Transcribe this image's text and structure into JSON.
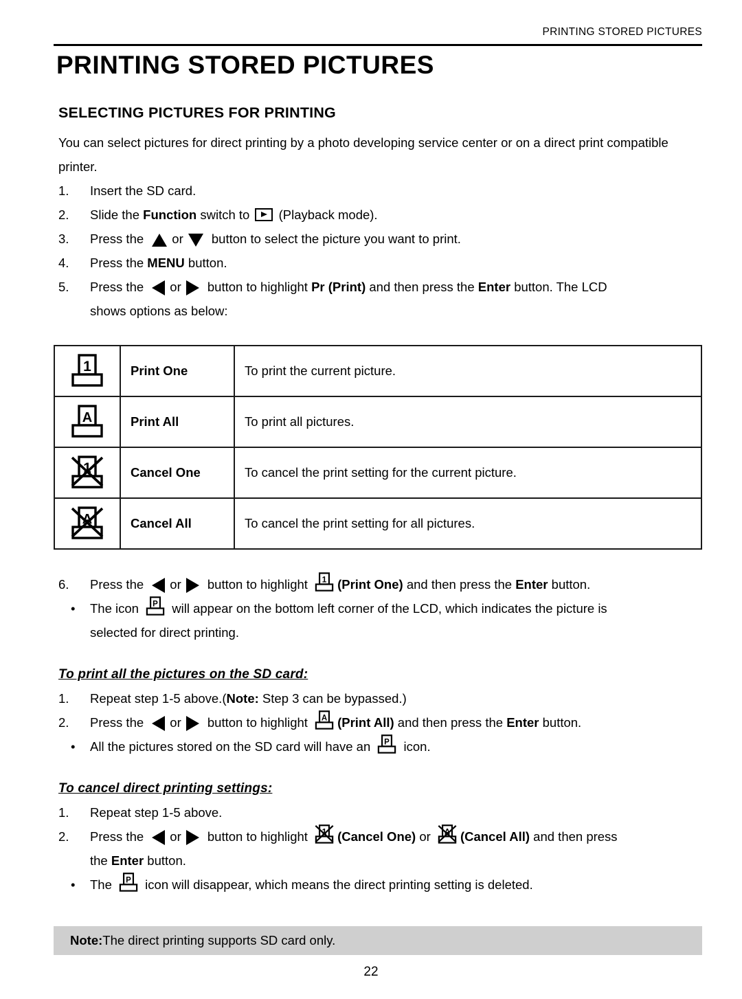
{
  "header": {
    "running_head": "PRINTING STORED PICTURES",
    "chapter_title": "PRINTING STORED PICTURES"
  },
  "section": {
    "heading": "SELECTING PICTURES FOR PRINTING",
    "intro": "You can select pictures for direct printing by a photo developing service center or on a direct print compatible printer."
  },
  "steps": {
    "s1": {
      "num": "1.",
      "text": "Insert the SD card."
    },
    "s2": {
      "num": "2.",
      "pre": "Slide the ",
      "bold": "Function",
      "mid": " switch to ",
      "post": " (Playback mode)."
    },
    "s3": {
      "num": "3.",
      "pre": "Press the ",
      "mid": "or",
      "post": " button to select the picture you want to print."
    },
    "s4": {
      "num": "4.",
      "pre": "Press the ",
      "bold": "MENU",
      "post": " button."
    },
    "s5": {
      "num": "5.",
      "pre": "Press the ",
      "mid": "or",
      "post": " button to highlight ",
      "bold1": "Pr (Print)",
      "post2": " and then press the ",
      "bold2": "Enter",
      "post3": " button. The LCD",
      "line2": "shows options as below:"
    },
    "s6": {
      "num": "6.",
      "pre": "Press the ",
      "mid": "or",
      "post": " button to highlight ",
      "bold1": "(Print One)",
      "post2": " and then press the ",
      "bold2": "Enter",
      "post3": " button."
    }
  },
  "bullets": {
    "b1": {
      "dot": "•",
      "pre": "The icon ",
      "post": " will appear on the bottom left corner of the LCD, which indicates the picture is",
      "line2": "selected for direct printing."
    },
    "b2": {
      "dot": "•",
      "pre": "All the pictures stored on the SD card will have an ",
      "post": " icon."
    },
    "b3": {
      "dot": "•",
      "pre": "The ",
      "post": " icon will disappear, which means the direct printing setting is deleted."
    }
  },
  "options_table": {
    "rows": [
      {
        "icon": "print-one-icon",
        "name": "Print One",
        "description": "To print the current picture."
      },
      {
        "icon": "print-all-icon",
        "name": "Print All",
        "description": "To print all pictures."
      },
      {
        "icon": "cancel-one-icon",
        "name": "Cancel One",
        "description": "To cancel the print setting for the current picture."
      },
      {
        "icon": "cancel-all-icon",
        "name": "Cancel All",
        "description": "To cancel the print setting for all pictures."
      }
    ]
  },
  "print_all_section": {
    "heading": "To print all the pictures on the SD card:",
    "step1": {
      "num": "1.",
      "pre": "Repeat step 1-5 above.(",
      "bold": "Note:",
      "post": " Step 3 can be bypassed.)"
    },
    "step2": {
      "num": "2.",
      "pre": "Press the ",
      "mid": "or",
      "post": " button to highlight ",
      "bold1": "(Print All)",
      "post2": " and then press the ",
      "bold2": "Enter",
      "post3": " button."
    }
  },
  "cancel_section": {
    "heading": "To cancel direct printing settings:",
    "step1": {
      "num": "1.",
      "text": "Repeat step 1-5 above."
    },
    "step2": {
      "num": "2.",
      "pre": "Press the ",
      "mid": "or",
      "post": " button to highlight ",
      "bold1": "(Cancel One)",
      "conj": " or ",
      "bold2": "(Cancel All)",
      "post2": " and then press",
      "line2_pre": "the ",
      "line2_bold": "Enter",
      "line2_post": " button."
    }
  },
  "note": {
    "bold": "Note:",
    "text": " The direct printing supports SD card only."
  },
  "footer": {
    "page_number": "22"
  },
  "colors": {
    "ink": "#000000",
    "note_background": "#cfcfcf",
    "table_border": "#1a1a1a"
  }
}
